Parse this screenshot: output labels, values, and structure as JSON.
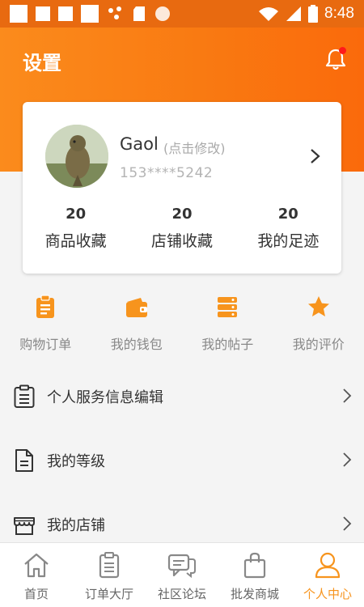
{
  "status_bar": {
    "time": "8:48"
  },
  "header": {
    "title": "设置"
  },
  "profile": {
    "name": "Gaol",
    "edit_hint": "(点击修改)",
    "phone": "153****5242"
  },
  "stats": [
    {
      "value": "20",
      "label": "商品收藏"
    },
    {
      "value": "20",
      "label": "店铺收藏"
    },
    {
      "value": "20",
      "label": "我的足迹"
    }
  ],
  "quick_menu": [
    {
      "label": "购物订单",
      "icon": "clipboard-icon"
    },
    {
      "label": "我的钱包",
      "icon": "wallet-icon"
    },
    {
      "label": "我的帖子",
      "icon": "stack-icon"
    },
    {
      "label": "我的评价",
      "icon": "star-icon"
    }
  ],
  "list": [
    {
      "label": "个人服务信息编辑",
      "icon": "clipboard-outline-icon"
    },
    {
      "label": "我的等级",
      "icon": "document-icon"
    },
    {
      "label": "我的店铺",
      "icon": "shop-icon"
    }
  ],
  "tab_bar": [
    {
      "label": "首页",
      "icon": "home-icon",
      "active": false
    },
    {
      "label": "订单大厅",
      "icon": "order-icon",
      "active": false
    },
    {
      "label": "社区论坛",
      "icon": "forum-icon",
      "active": false
    },
    {
      "label": "批发商城",
      "icon": "bag-icon",
      "active": false
    },
    {
      "label": "个人中心",
      "icon": "person-icon",
      "active": true
    }
  ],
  "colors": {
    "accent": "#f7941d",
    "header_gradient_start": "#fb8b1c",
    "header_gradient_end": "#fa6a0b",
    "notification_dot": "#ff1a1a"
  }
}
